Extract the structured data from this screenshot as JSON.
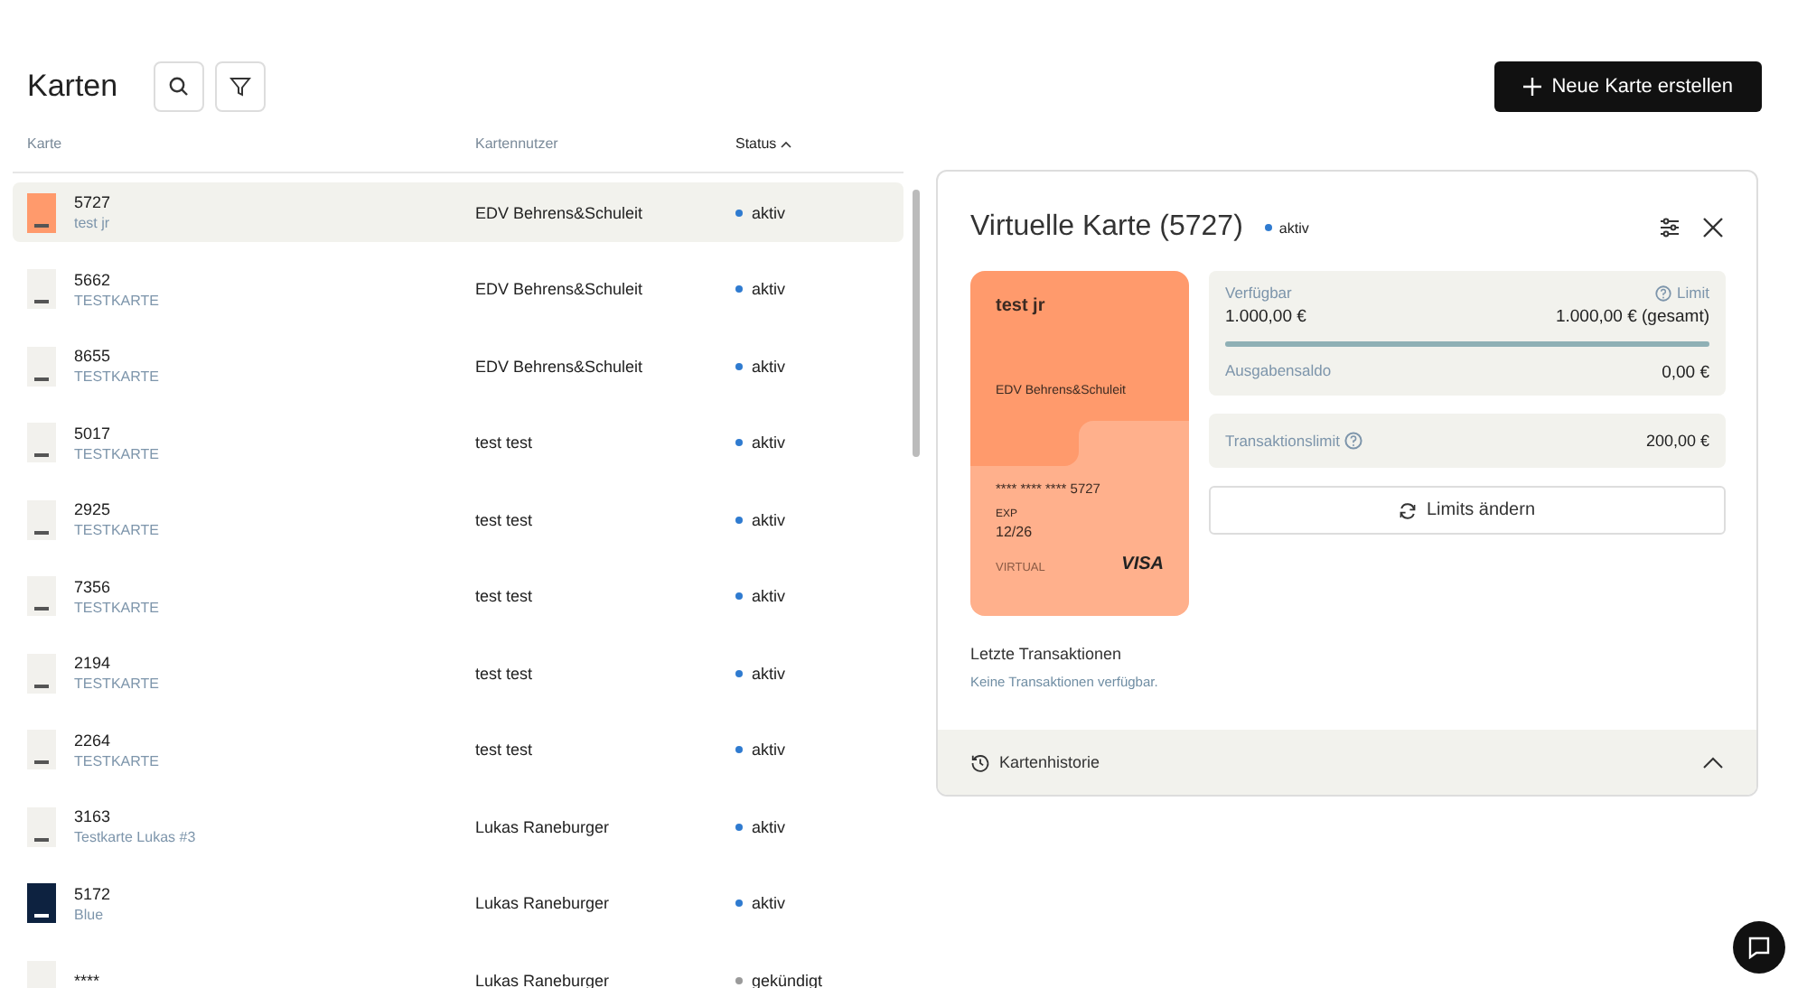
{
  "page": {
    "title": "Karten",
    "create_button": "Neue Karte erstellen"
  },
  "table": {
    "columns": [
      {
        "label": "Karte",
        "sorted": false
      },
      {
        "label": "Kartennutzer",
        "sorted": false
      },
      {
        "label": "Status",
        "sorted": true
      }
    ],
    "rows": [
      {
        "number": "5727",
        "name": "test jr",
        "user": "EDV Behrens&Schuleit",
        "status": {
          "label": "aktiv",
          "color": "#2f7bd0"
        },
        "color": "#ff9a6c",
        "selected": true
      },
      {
        "number": "5662",
        "name": "TESTKARTE",
        "user": "EDV Behrens&Schuleit",
        "status": {
          "label": "aktiv",
          "color": "#2f7bd0"
        },
        "color": "#f2f1ed",
        "selected": false
      },
      {
        "number": "8655",
        "name": "TESTKARTE",
        "user": "EDV Behrens&Schuleit",
        "status": {
          "label": "aktiv",
          "color": "#2f7bd0"
        },
        "color": "#f2f1ed",
        "selected": false
      },
      {
        "number": "5017",
        "name": "TESTKARTE",
        "user": "test test",
        "status": {
          "label": "aktiv",
          "color": "#2f7bd0"
        },
        "color": "#f2f1ed",
        "selected": false
      },
      {
        "number": "2925",
        "name": "TESTKARTE",
        "user": "test test",
        "status": {
          "label": "aktiv",
          "color": "#2f7bd0"
        },
        "color": "#f2f1ed",
        "selected": false
      },
      {
        "number": "7356",
        "name": "TESTKARTE",
        "user": "test test",
        "status": {
          "label": "aktiv",
          "color": "#2f7bd0"
        },
        "color": "#f2f1ed",
        "selected": false
      },
      {
        "number": "2194",
        "name": "TESTKARTE",
        "user": "test test",
        "status": {
          "label": "aktiv",
          "color": "#2f7bd0"
        },
        "color": "#f2f1ed",
        "selected": false
      },
      {
        "number": "2264",
        "name": "TESTKARTE",
        "user": "test test",
        "status": {
          "label": "aktiv",
          "color": "#2f7bd0"
        },
        "color": "#f2f1ed",
        "selected": false
      },
      {
        "number": "3163",
        "name": "Testkarte Lukas #3",
        "user": "Lukas Raneburger",
        "status": {
          "label": "aktiv",
          "color": "#2f7bd0"
        },
        "color": "#f2f1ed",
        "selected": false
      },
      {
        "number": "5172",
        "name": "Blue",
        "user": "Lukas Raneburger",
        "status": {
          "label": "aktiv",
          "color": "#2f7bd0"
        },
        "color": "#0d2240",
        "selected": false
      },
      {
        "number": "****",
        "user": "Lukas Raneburger",
        "status": {
          "label": "gekündigt",
          "color": "#9a9a9a"
        },
        "color": "#f2f1ed",
        "selected": false
      }
    ]
  },
  "detail": {
    "title": "Virtuelle Karte (5727)",
    "status": {
      "label": "aktiv",
      "color": "#2f7bd0"
    },
    "card": {
      "holder": "test jr",
      "company": "EDV Behrens&Schuleit",
      "number": "**** **** **** 5727",
      "exp_label": "EXP",
      "exp": "12/26",
      "type": "VIRTUAL",
      "brand": "VISA",
      "color": "#ff9a6c"
    },
    "balance": {
      "available_label": "Verfügbar",
      "available": "1.000,00 €",
      "limit_label": "Limit",
      "limit": "1.000,00 € (gesamt)",
      "level": 1,
      "spent_label": "Ausgabensaldo",
      "spent": "0,00 €"
    },
    "transaction_limit": {
      "label": "Transaktionslimit",
      "value": "200,00 €"
    },
    "limits_button": "Limits ändern",
    "transactions": {
      "title": "Letzte Transaktionen",
      "empty": "Keine Transaktionen verfügbar."
    },
    "history": {
      "label": "Kartenhistorie",
      "expanded": true
    }
  }
}
